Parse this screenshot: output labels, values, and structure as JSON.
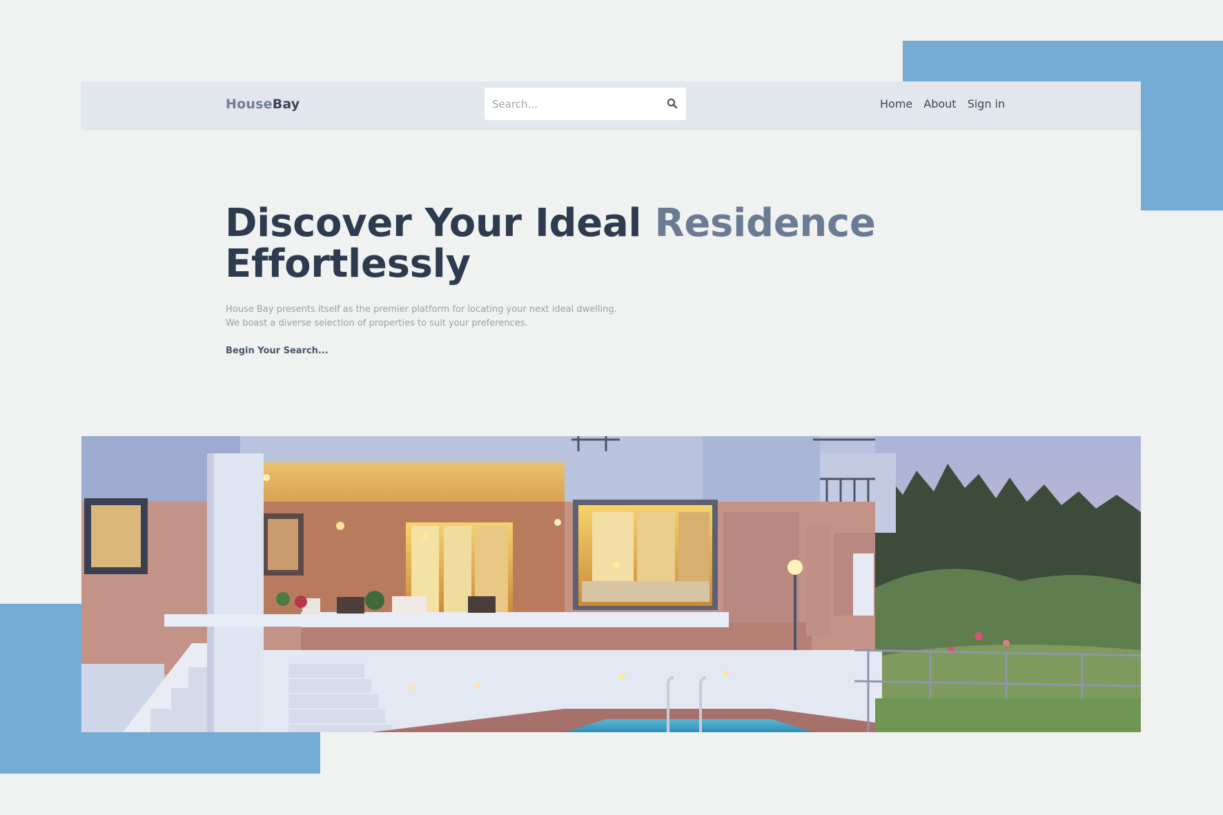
{
  "brand": {
    "part1": "House",
    "part2": "Bay"
  },
  "search": {
    "placeholder": "Search..."
  },
  "nav": {
    "items": [
      "Home",
      "About",
      "Sign in"
    ]
  },
  "hero": {
    "title_dark": "Discover Your Ideal ",
    "title_accent": "Residence",
    "title_line2": "Effortlessly",
    "desc_line1": "House Bay presents itself as the premier platform for locating your next ideal dwelling.",
    "desc_line2": "We boast a diverse selection of properties to suit your preferences.",
    "cta": "Begin Your Search..."
  },
  "colors": {
    "background": "#eff2f0",
    "navbar": "#e2e7ee",
    "accent_block": "#75acd5",
    "heading": "#2e3b4e",
    "heading_accent": "#6b7b93"
  },
  "icons": {
    "search": "search-icon"
  }
}
